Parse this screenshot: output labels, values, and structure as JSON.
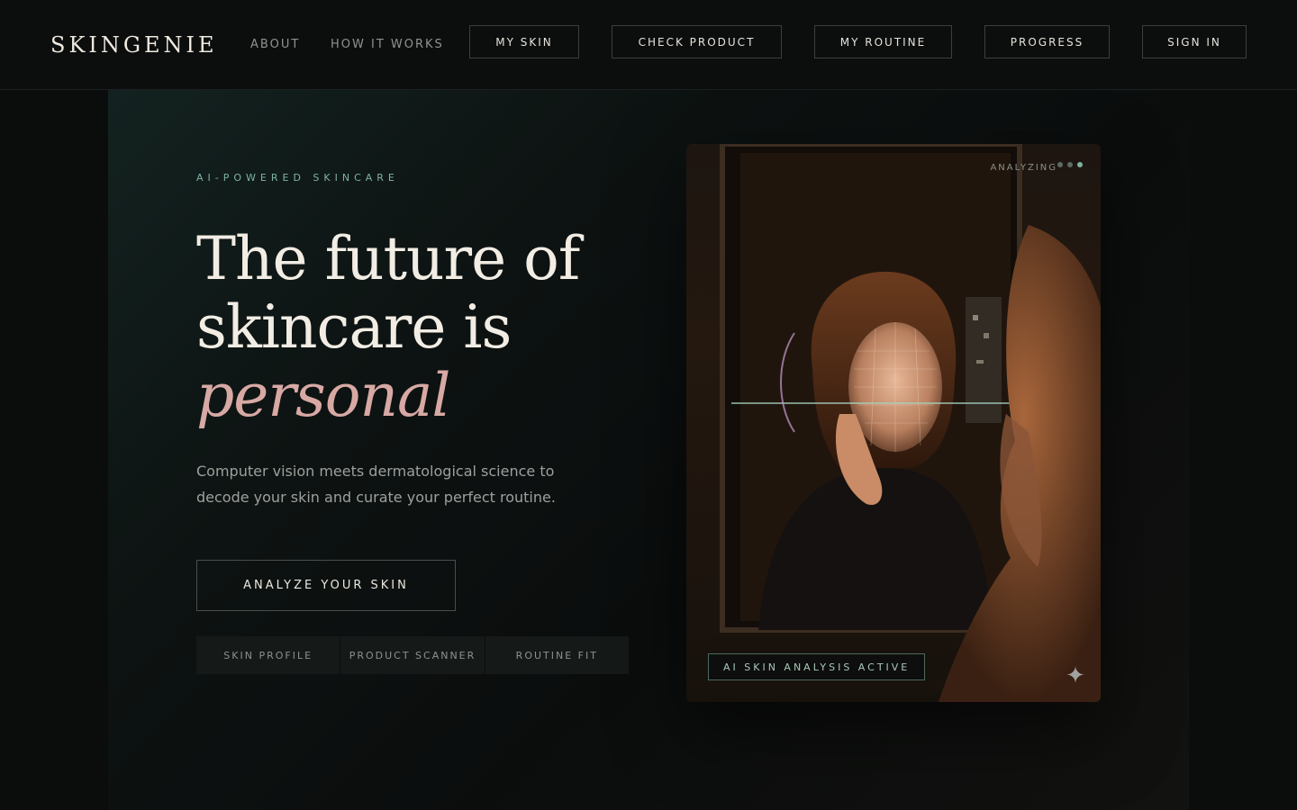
{
  "brand": {
    "name": "SKINGENIE"
  },
  "nav": {
    "links": [
      "ABOUT",
      "HOW IT WORKS"
    ],
    "buttons": [
      "MY SKIN",
      "CHECK PRODUCT",
      "MY ROUTINE",
      "PROGRESS",
      "SIGN IN"
    ]
  },
  "hero": {
    "eyebrow": "AI-POWERED SKINCARE",
    "headline_line1": "The future of",
    "headline_line2": "skincare is",
    "headline_accent": "personal",
    "subtitle": "Computer vision meets dermatological science to decode your skin and curate your perfect routine.",
    "cta_label": "ANALYZE YOUR SKIN",
    "tabs": [
      "SKIN PROFILE",
      "PRODUCT SCANNER",
      "ROUTINE FIT"
    ]
  },
  "visual": {
    "status_label": "ANALYZING",
    "badge_label": "AI SKIN ANALYSIS ACTIVE",
    "sparkle_icon": "sparkle-icon",
    "image_subject": "woman-looking-in-mirror-with-face-scan"
  },
  "colors": {
    "background": "#0b0d0d",
    "accent_teal": "#7fb3a0",
    "accent_rose": "#d8a9a4",
    "text_primary": "#f2ede4"
  }
}
